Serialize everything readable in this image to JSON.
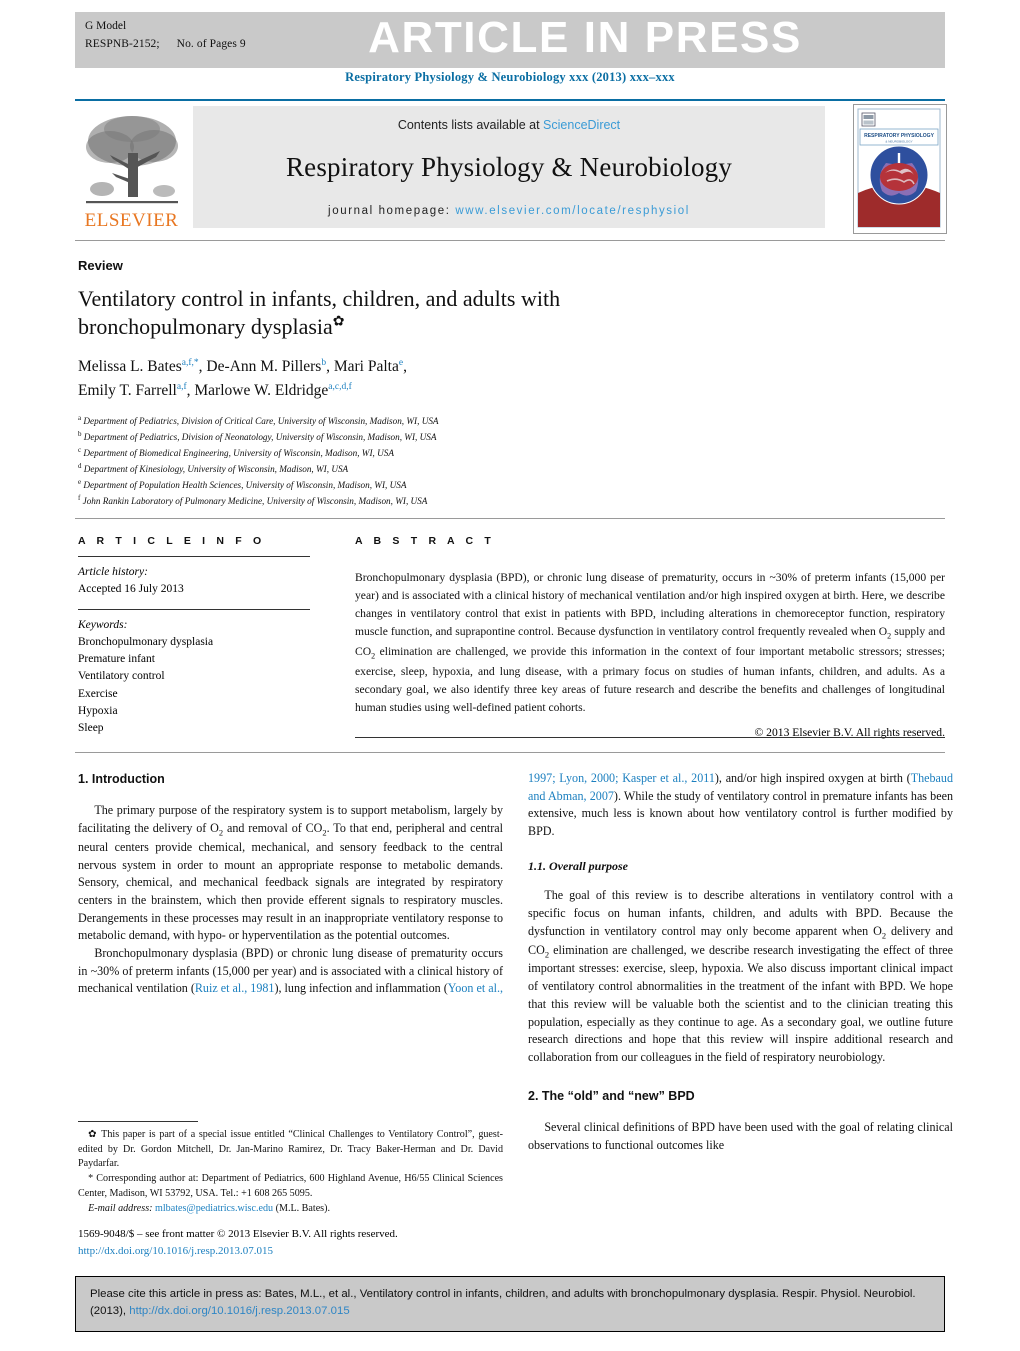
{
  "header": {
    "g_model": "G Model",
    "article_id": "RESPNB-2152;",
    "pages": "No. of Pages 9",
    "article_in_press": "ARTICLE IN PRESS",
    "running_head": "Respiratory Physiology & Neurobiology xxx (2013) xxx–xxx"
  },
  "masthead": {
    "contents_prefix": "Contents lists available at ",
    "sciencedirect": "ScienceDirect",
    "journal_title": "Respiratory Physiology & Neurobiology",
    "homepage_label": "journal homepage:",
    "homepage_url": "www.elsevier.com/locate/resphysiol",
    "publisher_name": "ELSEVIER",
    "cover_title": "RESPIRATORY PHYSIOLOGY & NEUROBIOLOGY",
    "cover_subtitle": "AN INTERNATIONAL JOURNAL OF RESPIRATORY NEUROSCIENCE"
  },
  "article": {
    "kicker": "Review",
    "title": "Ventilatory control in infants, children, and adults with bronchopulmonary dysplasia",
    "title_marker": "✿",
    "authors": [
      {
        "name": "Melissa L. Bates",
        "sups": "a,f,*"
      },
      {
        "name": "De-Ann M. Pillers",
        "sups": "b"
      },
      {
        "name": "Mari Palta",
        "sups": "e"
      },
      {
        "name": "Emily T. Farrell",
        "sups": "a,f"
      },
      {
        "name": "Marlowe W. Eldridge",
        "sups": "a,c,d,f"
      }
    ],
    "affiliations": [
      {
        "mark": "a",
        "text": "Department of Pediatrics, Division of Critical Care, University of Wisconsin, Madison, WI, USA"
      },
      {
        "mark": "b",
        "text": "Department of Pediatrics, Division of Neonatology, University of Wisconsin, Madison, WI, USA"
      },
      {
        "mark": "c",
        "text": "Department of Biomedical Engineering, University of Wisconsin, Madison, WI, USA"
      },
      {
        "mark": "d",
        "text": "Department of Kinesiology, University of Wisconsin, Madison, WI, USA"
      },
      {
        "mark": "e",
        "text": "Department of Population Health Sciences, University of Wisconsin, Madison, WI, USA"
      },
      {
        "mark": "f",
        "text": "John Rankin Laboratory of Pulmonary Medicine, University of Wisconsin, Madison, WI, USA"
      }
    ]
  },
  "article_info": {
    "heading": "A R T I C L E    I N F O",
    "history_label": "Article history:",
    "history_value": "Accepted 16 July 2013",
    "keywords_label": "Keywords:",
    "keywords": [
      "Bronchopulmonary dysplasia",
      "Premature infant",
      "Ventilatory control",
      "Exercise",
      "Hypoxia",
      "Sleep"
    ]
  },
  "abstract": {
    "heading": "A B S T R A C T",
    "body": "Bronchopulmonary dysplasia (BPD), or chronic lung disease of prematurity, occurs in ~30% of preterm infants (15,000 per year) and is associated with a clinical history of mechanical ventilation and/or high inspired oxygen at birth. Here, we describe changes in ventilatory control that exist in patients with BPD, including alterations in chemoreceptor function, respiratory muscle function, and suprapontine control. Because dysfunction in ventilatory control frequently revealed when O2 supply and CO2 elimination are challenged, we provide this information in the context of four important metabolic stressors; stresses; exercise, sleep, hypoxia, and lung disease, with a primary focus on studies of human infants, children, and adults. As a secondary goal, we also identify three key areas of future research and describe the benefits and challenges of longitudinal human studies using well-defined patient cohorts.",
    "copyright": "© 2013 Elsevier B.V. All rights reserved."
  },
  "body": {
    "intro_heading": "1.  Introduction",
    "intro_p1_a": "The primary purpose of the respiratory system is to support metabolism, largely by facilitating the delivery of O",
    "intro_p1_b": " and removal of CO",
    "intro_p1_c": ". To that end, peripheral and central neural centers provide chemical, mechanical, and sensory feedback to the central nervous system in order to mount an appropriate response to metabolic demands. Sensory, chemical, and mechanical feedback signals are integrated by respiratory centers in the brainstem, which then provide efferent signals to respiratory muscles. Derangements in these processes may result in an inappropriate ventilatory response to metabolic demand, with hypo- or hyperventilation as the potential outcomes.",
    "intro_p2_a": "Bronchopulmonary dysplasia (BPD) or chronic lung disease of prematurity occurs in ~30% of preterm infants (15,000 per year) and is associated with a clinical history of mechanical ventilation (",
    "intro_p2_ref1": "Ruiz et al., 1981",
    "intro_p2_b": "), lung infection and inflammation (",
    "intro_p2_ref2": "Yoon et al.,",
    "right_cont_ref1": "1997; Lyon, 2000; Kasper et al., 2011",
    "right_cont_a": "), and/or high inspired oxygen at birth (",
    "right_cont_ref2": "Thebaud and Abman, 2007",
    "right_cont_b": "). While the study of ventilatory control in premature infants has been extensive, much less is known about how ventilatory control is further modified by BPD.",
    "purpose_heading": "1.1.  Overall purpose",
    "purpose_a": "The goal of this review is to describe alterations in ventilatory control with a specific focus on human infants, children, and adults with BPD. Because the dysfunction in ventilatory control may only become apparent when O",
    "purpose_b": " delivery and CO",
    "purpose_c": " elimination are challenged, we describe research investigating the effect of three important stresses: exercise, sleep, hypoxia. We also discuss important clinical impact of ventilatory control abnormalities in the treatment of the infant with BPD. We hope that this review will be valuable both the scientist and to the clinician treating this population, especially as they continue to age. As a secondary goal, we outline future research directions and hope that this review will inspire additional research and collaboration from our colleagues in the field of respiratory neurobiology.",
    "oldnew_heading": "2.  The “old” and “new” BPD",
    "oldnew_p1": "Several clinical definitions of BPD have been used with the goal of relating clinical observations to functional outcomes like"
  },
  "footnotes": {
    "star_marker": "✿",
    "star_text": " This paper is part of a special issue entitled “Clinical Challenges to Ventilatory Control”, guest-edited by Dr. Gordon Mitchell, Dr. Jan-Marino Ramirez, Dr. Tracy Baker-Herman and Dr. David Paydarfar.",
    "corresp_marker": "*",
    "corresp_text": " Corresponding author at: Department of Pediatrics, 600 Highland Avenue, H6/55 Clinical Sciences Center, Madison, WI 53792, USA. Tel.: +1 608 265 5095.",
    "email_label": "E-mail address:",
    "email": "mlbates@pediatrics.wisc.edu",
    "email_suffix": " (M.L. Bates).",
    "issn_line": "1569-9048/$ – see front matter © 2013 Elsevier B.V. All rights reserved.",
    "doi_line": "http://dx.doi.org/10.1016/j.resp.2013.07.015"
  },
  "cite_box": {
    "text": "Please cite this article in press as: Bates, M.L., et al., Ventilatory control in infants, children, and adults with bronchopulmonary dysplasia. Respir. Physiol. Neurobiol. (2013), ",
    "doi": "http://dx.doi.org/10.1016/j.resp.2013.07.015"
  },
  "colors": {
    "journal_blue": "#0a6ea3",
    "link_blue": "#1b7fbf",
    "elsevier_orange": "#e87722",
    "bar_gray": "#c9c9c9",
    "box_gray": "#e8e8e8"
  }
}
